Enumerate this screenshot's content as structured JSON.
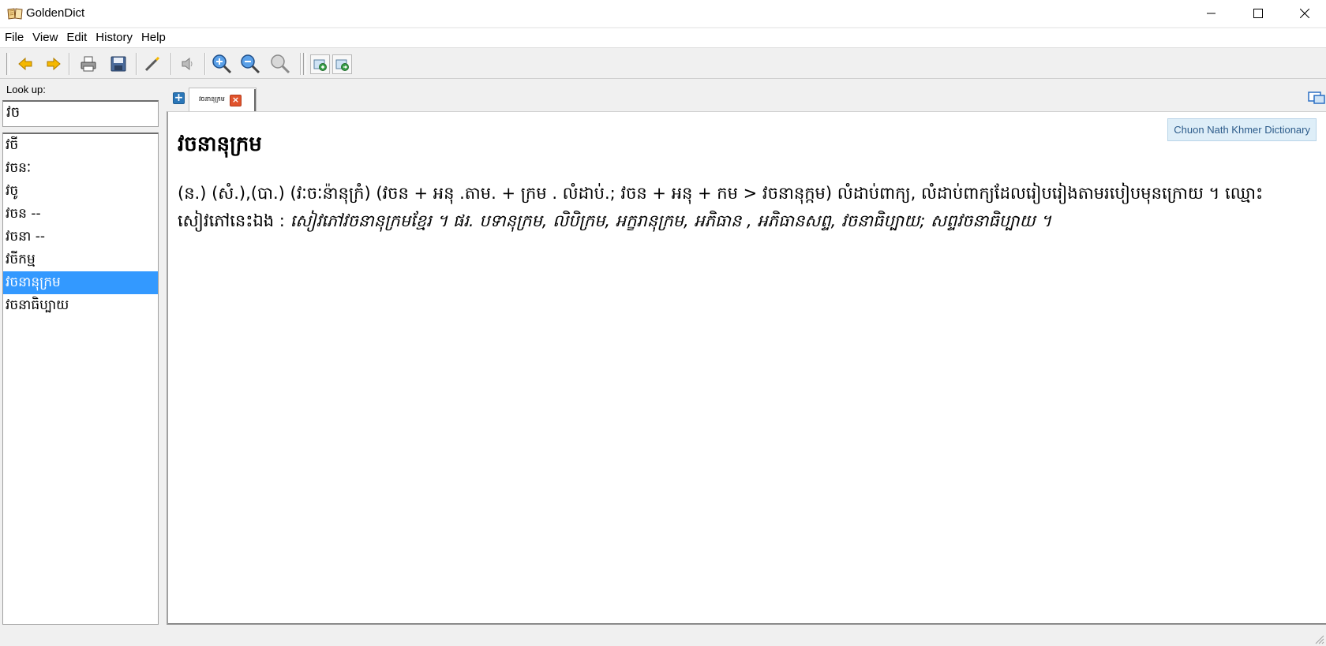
{
  "window": {
    "title": "GoldenDict",
    "icons": {
      "app": "book-icon",
      "minimize": "minimize-icon",
      "maximize": "maximize-icon",
      "close": "close-icon"
    }
  },
  "menu": [
    "File",
    "View",
    "Edit",
    "History",
    "Help"
  ],
  "toolbar": {
    "icons": [
      "back-arrow-icon",
      "forward-arrow-icon",
      "print-icon",
      "save-icon",
      "magic-wand-icon",
      "speaker-icon",
      "zoom-in-icon",
      "zoom-out-icon",
      "zoom-reset-icon",
      "scan-popup-icon",
      "show-main-window-icon"
    ],
    "colors": {
      "arrow": "#f5b800",
      "zoom": "#2a6fc4"
    }
  },
  "lookup": {
    "label": "Look up:",
    "value": "វច"
  },
  "suggestions": {
    "items": [
      "វចី",
      "វចនៈ",
      "វចូ",
      "វចន --",
      "វចនា --",
      "វចីកម្ម",
      "វចនានុក្រម",
      "វចនាធិប្បាយ"
    ],
    "selected_index": 6
  },
  "tabs": {
    "items": [
      {
        "label": "វចនានុក្រម"
      }
    ]
  },
  "article": {
    "dictionary": "Chuon Nath Khmer Dictionary",
    "headword": "វចនានុក្រម",
    "definition_main": "(ន.) (សំ.),(បា.) (វៈចៈន៉ានុក្រំ) (វចន + អនុ .តាម. + ក្រម . លំដាប់.; វចន + អនុ + កម > វចនានុក្កម) លំដាប់ពាក្យ, លំដាប់ពាក្យដែលរៀបរៀងតាមរបៀបមុនក្រោយ ។ ឈ្មោះសៀវភៅនេះឯង : ",
    "definition_example": "សៀវភៅវចនានុក្រមខ្មែរ ។ ផរ. បទានុក្រម, លិបិក្រម, អក្ខរានុក្រម, អភិធាន , អភិធានសព្ទ, វចនាធិប្បាយ; សព្ទវចនាធិប្បាយ ។"
  },
  "colors": {
    "selection": "#3399ff",
    "badge_bg": "#deeef8",
    "badge_text": "#2c5b8a",
    "tab_close": "#e0532c",
    "new_tab": "#2a76b8"
  }
}
